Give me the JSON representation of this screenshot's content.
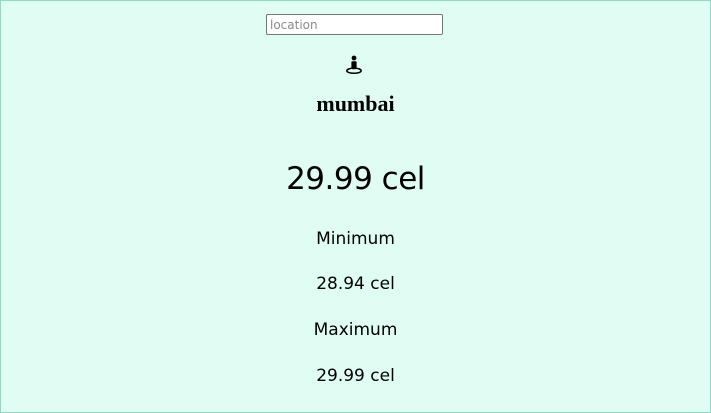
{
  "search": {
    "placeholder": "location",
    "value": ""
  },
  "icons": {
    "location": "person-pin-icon"
  },
  "weather": {
    "city": "mumbai",
    "temperature": "29.99 cel",
    "minimum_label": "Minimum",
    "minimum_value": "28.94 cel",
    "maximum_label": "Maximum",
    "maximum_value": "29.99 cel"
  },
  "colors": {
    "background": "#e0fdf4",
    "border": "#8fd9c6"
  }
}
